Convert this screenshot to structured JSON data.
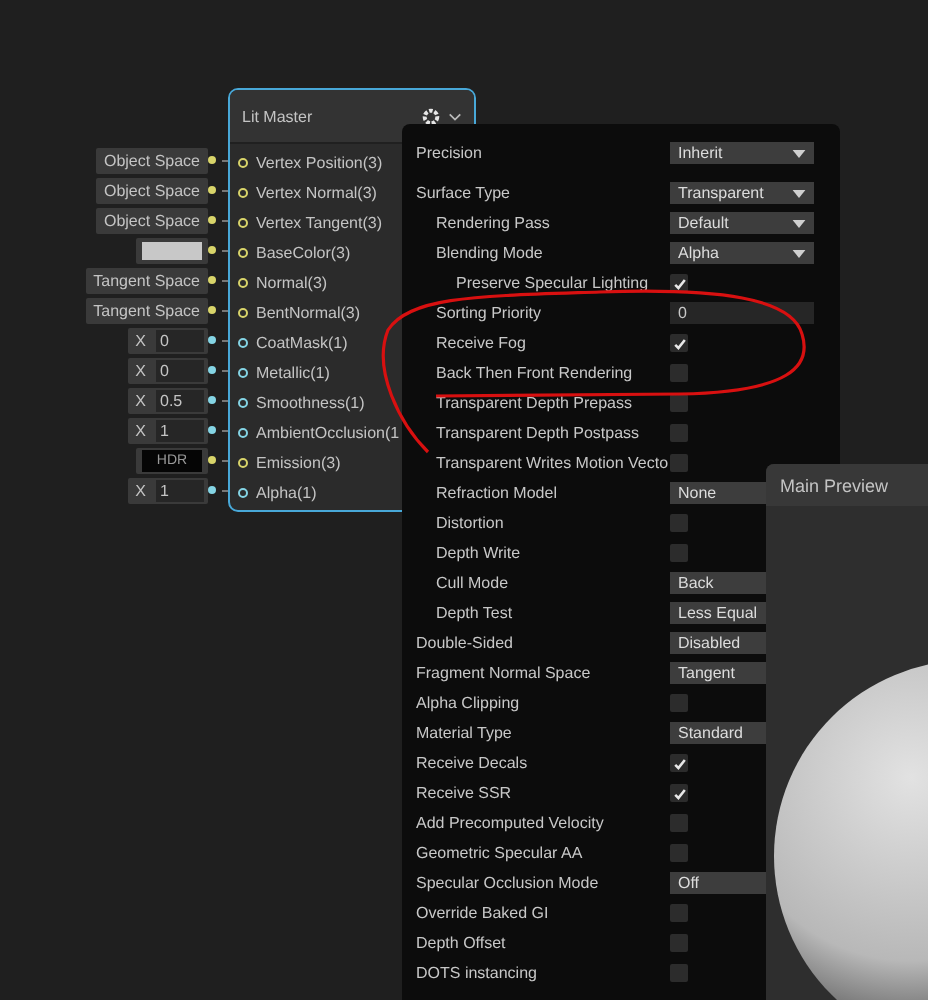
{
  "node": {
    "title": "Lit Master",
    "ports": [
      {
        "label": "Vertex Position(3)",
        "color": "#d8d46a",
        "input": {
          "kind": "text",
          "value": "Object Space"
        }
      },
      {
        "label": "Vertex Normal(3)",
        "color": "#d8d46a",
        "input": {
          "kind": "text",
          "value": "Object Space"
        }
      },
      {
        "label": "Vertex Tangent(3)",
        "color": "#d8d46a",
        "input": {
          "kind": "text",
          "value": "Object Space"
        }
      },
      {
        "label": "BaseColor(3)",
        "color": "#d8d46a",
        "input": {
          "kind": "color"
        }
      },
      {
        "label": "Normal(3)",
        "color": "#d8d46a",
        "input": {
          "kind": "text",
          "value": "Tangent Space"
        }
      },
      {
        "label": "BentNormal(3)",
        "color": "#d8d46a",
        "input": {
          "kind": "text",
          "value": "Tangent Space"
        }
      },
      {
        "label": "CoatMask(1)",
        "color": "#84d4e4",
        "input": {
          "kind": "float",
          "axis": "X",
          "value": "0"
        }
      },
      {
        "label": "Metallic(1)",
        "color": "#84d4e4",
        "input": {
          "kind": "float",
          "axis": "X",
          "value": "0"
        }
      },
      {
        "label": "Smoothness(1)",
        "color": "#84d4e4",
        "input": {
          "kind": "float",
          "axis": "X",
          "value": "0.5"
        }
      },
      {
        "label": "AmbientOcclusion(1",
        "color": "#84d4e4",
        "input": {
          "kind": "float",
          "axis": "X",
          "value": "1"
        }
      },
      {
        "label": "Emission(3)",
        "color": "#d8d46a",
        "input": {
          "kind": "hdr",
          "value": "HDR"
        }
      },
      {
        "label": "Alpha(1)",
        "color": "#84d4e4",
        "input": {
          "kind": "float",
          "axis": "X",
          "value": "1"
        }
      }
    ]
  },
  "settings": [
    {
      "label": "Precision",
      "kind": "dropdown",
      "value": "Inherit"
    },
    {
      "label": "Surface Type",
      "kind": "dropdown",
      "value": "Transparent",
      "children": [
        {
          "label": "Rendering Pass",
          "kind": "dropdown",
          "value": "Default"
        },
        {
          "label": "Blending Mode",
          "kind": "dropdown",
          "value": "Alpha",
          "children": [
            {
              "label": "Preserve Specular Lighting",
              "kind": "checkbox",
              "checked": true
            }
          ]
        },
        {
          "label": "Sorting Priority",
          "kind": "number",
          "value": "0"
        },
        {
          "label": "Receive Fog",
          "kind": "checkbox",
          "checked": true
        },
        {
          "label": "Back Then Front Rendering",
          "kind": "checkbox",
          "checked": false
        },
        {
          "label": "Transparent Depth Prepass",
          "kind": "checkbox",
          "checked": false
        },
        {
          "label": "Transparent Depth Postpass",
          "kind": "checkbox",
          "checked": false
        },
        {
          "label": "Transparent Writes Motion Vecto",
          "kind": "checkbox",
          "checked": false
        },
        {
          "label": "Refraction Model",
          "kind": "dropdown",
          "value": "None"
        },
        {
          "label": "Distortion",
          "kind": "checkbox",
          "checked": false
        },
        {
          "label": "Depth Write",
          "kind": "checkbox",
          "checked": false
        },
        {
          "label": "Cull Mode",
          "kind": "dropdown",
          "value": "Back"
        },
        {
          "label": "Depth Test",
          "kind": "dropdown",
          "value": "Less Equal"
        }
      ]
    },
    {
      "label": "Double-Sided",
      "kind": "dropdown",
      "value": "Disabled"
    },
    {
      "label": "Fragment Normal Space",
      "kind": "dropdown",
      "value": "Tangent"
    },
    {
      "label": "Alpha Clipping",
      "kind": "checkbox",
      "checked": false
    },
    {
      "label": "Material Type",
      "kind": "dropdown",
      "value": "Standard"
    },
    {
      "label": "Receive Decals",
      "kind": "checkbox",
      "checked": true
    },
    {
      "label": "Receive SSR",
      "kind": "checkbox",
      "checked": true
    },
    {
      "label": "Add Precomputed Velocity",
      "kind": "checkbox",
      "checked": false
    },
    {
      "label": "Geometric Specular AA",
      "kind": "checkbox",
      "checked": false
    },
    {
      "label": "Specular Occlusion Mode",
      "kind": "dropdown",
      "value": "Off"
    },
    {
      "label": "Override Baked GI",
      "kind": "checkbox",
      "checked": false
    },
    {
      "label": "Depth Offset",
      "kind": "checkbox",
      "checked": false
    },
    {
      "label": "DOTS instancing",
      "kind": "checkbox",
      "checked": false
    }
  ],
  "preview": {
    "title": "Main Preview"
  }
}
